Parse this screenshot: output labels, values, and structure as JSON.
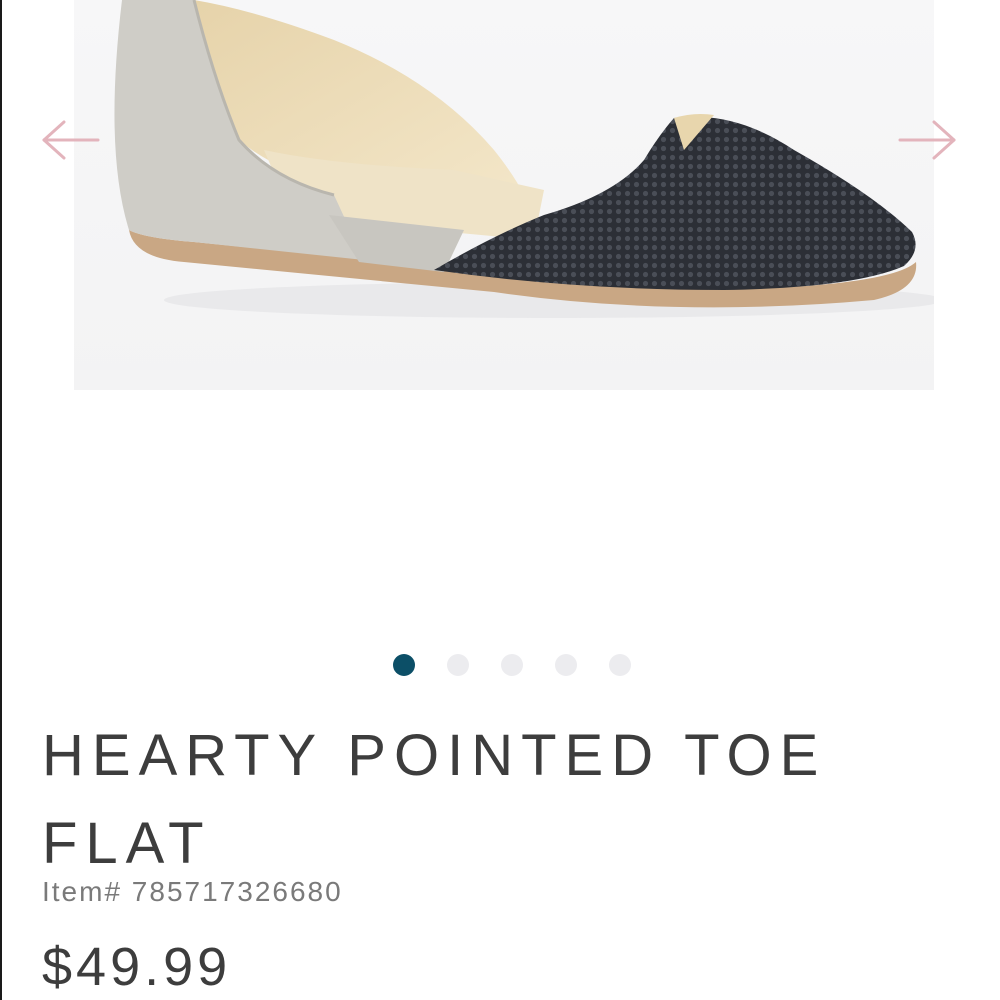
{
  "gallery": {
    "prev_icon": "arrow-left-icon",
    "next_icon": "arrow-right-icon",
    "arrow_color": "#e3b4bc",
    "active_slide": 1,
    "slide_count": 5,
    "active_dot_color": "#0c4f67",
    "inactive_dot_color": "#ececef"
  },
  "product": {
    "title": "HEARTY POINTED TOE FLAT",
    "item_number": "Item# 785717326680",
    "price": "$49.99"
  }
}
